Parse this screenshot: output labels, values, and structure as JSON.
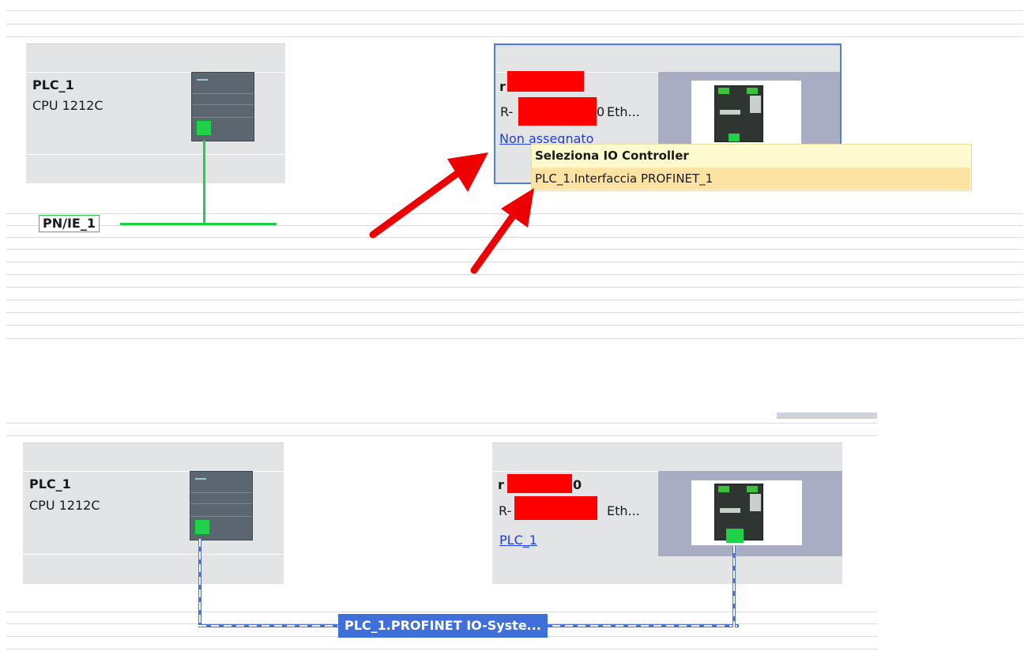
{
  "top_view": {
    "plc": {
      "name": "PLC_1",
      "type": "CPU 1212C"
    },
    "network_label": "PN/IE_1",
    "device": {
      "name_prefix": "r",
      "model_prefix": "R-",
      "model_mid": "0",
      "model_suffix": "Eth...",
      "controller_link": "Non assegnato"
    },
    "tooltip": {
      "title": "Seleziona IO Controller",
      "option": "PLC_1.Interfaccia PROFINET_1"
    }
  },
  "bottom_view": {
    "plc": {
      "name": "PLC_1",
      "type": "CPU 1212C"
    },
    "device": {
      "name_prefix": "r",
      "name_suffix": "0",
      "model_prefix": "R-",
      "model_suffix": "Eth...",
      "controller_link": "PLC_1"
    },
    "io_system_label": "PLC_1.PROFINET IO-Syste..."
  },
  "colors": {
    "network_green": "#1fcf45",
    "io_system_blue": "#3f6fd8",
    "selection_blue": "#4f7fd6",
    "redaction_red": "#ff0000",
    "annotation_arrow": "#ee0000",
    "tooltip_bg": "#fdfacd",
    "tooltip_highlight": "#fde3a3"
  },
  "icons": [
    "plc-cpu-icon",
    "io-device-module-icon",
    "red-annotation-arrow-icon"
  ]
}
